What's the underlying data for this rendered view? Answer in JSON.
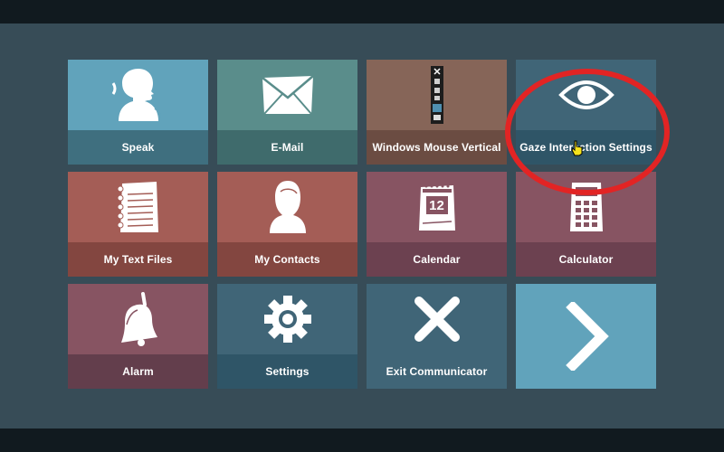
{
  "tiles": [
    {
      "label": "Speak",
      "icon": "speaking-head-icon",
      "color": "#61a3bb",
      "label_bg": "#3f6f7f"
    },
    {
      "label": "E-Mail",
      "icon": "envelope-icon",
      "color": "#5a8d8b",
      "label_bg": "#3f6b6c"
    },
    {
      "label": "Windows Mouse Vertical",
      "icon": "mouse-toolbar-icon",
      "color": "#866558",
      "label_bg": "#6b4c42"
    },
    {
      "label": "Gaze Interaction Settings",
      "icon": "eye-icon",
      "color": "#406577",
      "label_bg": "#2f5567"
    },
    {
      "label": "My Text Files",
      "icon": "notepad-icon",
      "color": "#a45d56",
      "label_bg": "#834640"
    },
    {
      "label": "My Contacts",
      "icon": "person-icon",
      "color": "#a45d56",
      "label_bg": "#834640"
    },
    {
      "label": "Calendar",
      "icon": "calendar-icon",
      "color": "#875462",
      "label_bg": "#6c4150"
    },
    {
      "label": "Calculator",
      "icon": "calculator-icon",
      "color": "#875462",
      "label_bg": "#6c4150"
    },
    {
      "label": "Alarm",
      "icon": "bell-icon",
      "color": "#875462",
      "label_bg": "#633e4c"
    },
    {
      "label": "Settings",
      "icon": "gear-icon",
      "color": "#406577",
      "label_bg": "#2f5567"
    },
    {
      "label": "Exit Communicator",
      "icon": "close-icon",
      "color": "#406577",
      "label_bg": "#406577"
    },
    {
      "label": "",
      "icon": "chevron-right-icon",
      "color": "#61a3bb",
      "label_bg": "#61a3bb"
    }
  ],
  "calendar_day": "12",
  "highlight_color": "#e22424",
  "cursor_icon": "hand-pointer-icon"
}
